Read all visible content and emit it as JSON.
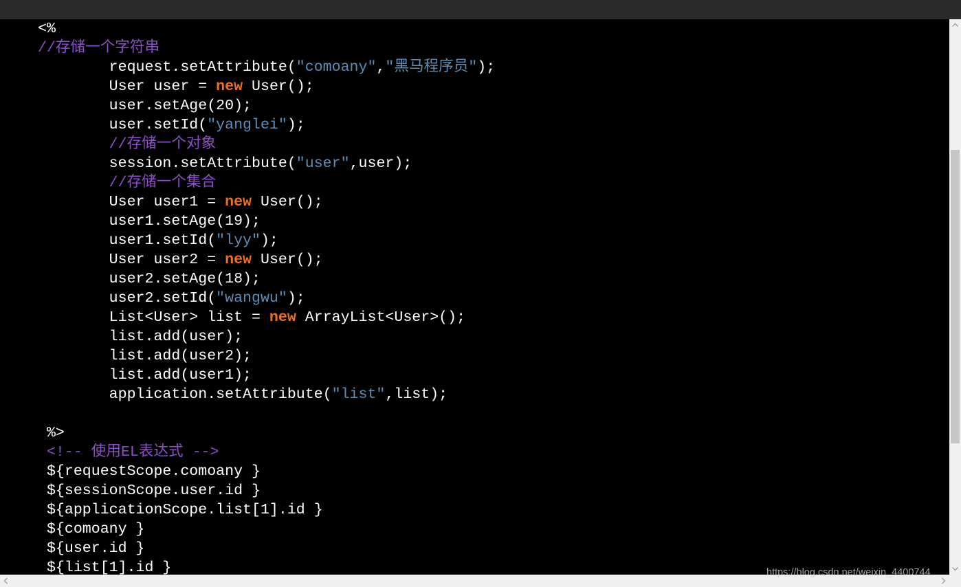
{
  "editor": {
    "theme": {
      "background": "#000000",
      "toolbar": "#2b2b2b",
      "text": "#ffffff",
      "string": "#5f8db8",
      "keyword": "#f0701e",
      "comment": "#8c50c8",
      "scrollbar_track": "#f0f0f0",
      "scrollbar_thumb": "#c6c6c6"
    },
    "lines": [
      [
        {
          "plain": "<%"
        }
      ],
      [
        {
          "comment": "//存储一个字符串"
        }
      ],
      [
        {
          "plain": "        request.setAttribute("
        },
        {
          "string": "\"comoany\""
        },
        {
          "plain": ","
        },
        {
          "string": "\"黑马程序员\""
        },
        {
          "plain": ");"
        }
      ],
      [
        {
          "plain": "        User user = "
        },
        {
          "keyword": "new"
        },
        {
          "plain": " User();"
        }
      ],
      [
        {
          "plain": "        user.setAge(20);"
        }
      ],
      [
        {
          "plain": "        user.setId("
        },
        {
          "string": "\"yanglei\""
        },
        {
          "plain": ");"
        }
      ],
      [
        {
          "comment": "        //存储一个对象"
        }
      ],
      [
        {
          "plain": "        session.setAttribute("
        },
        {
          "string": "\"user\""
        },
        {
          "plain": ",user);"
        }
      ],
      [
        {
          "comment": "        //存储一个集合"
        }
      ],
      [
        {
          "plain": "        User user1 = "
        },
        {
          "keyword": "new"
        },
        {
          "plain": " User();"
        }
      ],
      [
        {
          "plain": "        user1.setAge(19);"
        }
      ],
      [
        {
          "plain": "        user1.setId("
        },
        {
          "string": "\"lyy\""
        },
        {
          "plain": ");"
        }
      ],
      [
        {
          "plain": "        User user2 = "
        },
        {
          "keyword": "new"
        },
        {
          "plain": " User();"
        }
      ],
      [
        {
          "plain": "        user2.setAge(18);"
        }
      ],
      [
        {
          "plain": "        user2.setId("
        },
        {
          "string": "\"wangwu\""
        },
        {
          "plain": ");"
        }
      ],
      [
        {
          "plain": "        List<User> list = "
        },
        {
          "keyword": "new"
        },
        {
          "plain": " ArrayList<User>();"
        }
      ],
      [
        {
          "plain": "        list.add(user);"
        }
      ],
      [
        {
          "plain": "        list.add(user2);"
        }
      ],
      [
        {
          "plain": "        list.add(user1);"
        }
      ],
      [
        {
          "plain": "        application.setAttribute("
        },
        {
          "string": "\"list\""
        },
        {
          "plain": ",list);"
        }
      ],
      [],
      [
        {
          "plain": " %>"
        }
      ],
      [
        {
          "comment": " <!-- 使用EL表达式 -->"
        }
      ],
      [
        {
          "plain": " ${requestScope.comoany }"
        }
      ],
      [
        {
          "plain": " ${sessionScope.user.id }"
        }
      ],
      [
        {
          "plain": " ${applicationScope.list[1].id }"
        }
      ],
      [
        {
          "plain": " ${comoany }"
        }
      ],
      [
        {
          "plain": " ${user.id }"
        }
      ],
      [
        {
          "plain": " ${list[1].id }"
        }
      ]
    ]
  },
  "watermark": "https://blog.csdn.net/weixin_4400744"
}
